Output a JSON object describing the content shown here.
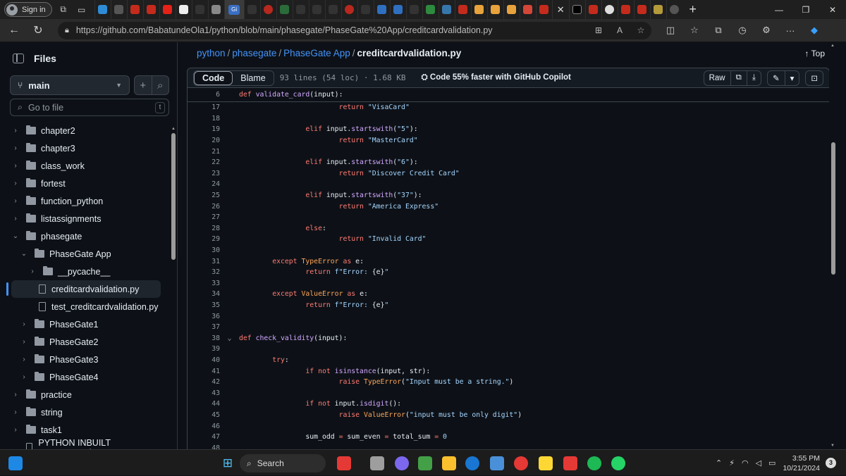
{
  "browser": {
    "signin_label": "Sign in",
    "active_tab_label": "Gi",
    "url": "https://github.com/BabatundeOla1/python/blob/main/phasegate/PhaseGate%20App/creditcardvalidation.py"
  },
  "sidebar": {
    "title": "Files",
    "branch": "main",
    "goto_placeholder": "Go to file",
    "goto_shortcut": "t",
    "items": [
      {
        "label": "chapter2",
        "type": "folder",
        "level": 0,
        "expanded": false
      },
      {
        "label": "chapter3",
        "type": "folder",
        "level": 0,
        "expanded": false
      },
      {
        "label": "class_work",
        "type": "folder",
        "level": 0,
        "expanded": false
      },
      {
        "label": "fortest",
        "type": "folder",
        "level": 0,
        "expanded": false
      },
      {
        "label": "function_python",
        "type": "folder",
        "level": 0,
        "expanded": false
      },
      {
        "label": "listassignments",
        "type": "folder",
        "level": 0,
        "expanded": false
      },
      {
        "label": "phasegate",
        "type": "folder",
        "level": 0,
        "expanded": true
      },
      {
        "label": "PhaseGate App",
        "type": "folder",
        "level": 1,
        "expanded": true
      },
      {
        "label": "__pycache__",
        "type": "folder",
        "level": 2,
        "expanded": false
      },
      {
        "label": "creditcardvalidation.py",
        "type": "file",
        "level": 2,
        "selected": true
      },
      {
        "label": "test_creditcardvalidation.py",
        "type": "file",
        "level": 2
      },
      {
        "label": "PhaseGate1",
        "type": "folder",
        "level": 1,
        "expanded": false
      },
      {
        "label": "PhaseGate2",
        "type": "folder",
        "level": 1,
        "expanded": false
      },
      {
        "label": "PhaseGate3",
        "type": "folder",
        "level": 1,
        "expanded": false
      },
      {
        "label": "PhaseGate4",
        "type": "folder",
        "level": 1,
        "expanded": false
      },
      {
        "label": "practice",
        "type": "folder",
        "level": 0,
        "expanded": false
      },
      {
        "label": "string",
        "type": "folder",
        "level": 0,
        "expanded": false
      },
      {
        "label": "task1",
        "type": "folder",
        "level": 0,
        "expanded": false
      },
      {
        "label": "PYTHON INBUILT FUNCTION.docx",
        "type": "file",
        "level": 0
      }
    ]
  },
  "breadcrumb": {
    "parts": [
      "python",
      "phasegate",
      "PhaseGate App"
    ],
    "current": "creditcardvalidation.py",
    "top_label": "Top"
  },
  "file_header": {
    "code_tab": "Code",
    "blame_tab": "Blame",
    "meta": "93 lines (54 loc) · 1.68 KB",
    "copilot": "Code 55% faster with GitHub Copilot",
    "raw_label": "Raw"
  },
  "code": {
    "sticky": {
      "num": "6",
      "text": "def validate_card(input):"
    },
    "lines": [
      {
        "num": "17",
        "indent": 3,
        "tokens": [
          [
            "kw",
            "return "
          ],
          [
            "st",
            "\"VisaCard\""
          ]
        ]
      },
      {
        "num": "18",
        "indent": 0,
        "tokens": []
      },
      {
        "num": "19",
        "indent": 2,
        "tokens": [
          [
            "kw",
            "elif "
          ],
          [
            "t",
            "input."
          ],
          [
            "fn",
            "startswith"
          ],
          [
            "t",
            "("
          ],
          [
            "st",
            "\"5\""
          ],
          [
            "t",
            "):"
          ]
        ]
      },
      {
        "num": "20",
        "indent": 3,
        "tokens": [
          [
            "kw",
            "return "
          ],
          [
            "st",
            "\"MasterCard\""
          ]
        ]
      },
      {
        "num": "21",
        "indent": 0,
        "tokens": []
      },
      {
        "num": "22",
        "indent": 2,
        "tokens": [
          [
            "kw",
            "elif "
          ],
          [
            "t",
            "input."
          ],
          [
            "fn",
            "startswith"
          ],
          [
            "t",
            "("
          ],
          [
            "st",
            "\"6\""
          ],
          [
            "t",
            "):"
          ]
        ]
      },
      {
        "num": "23",
        "indent": 3,
        "tokens": [
          [
            "kw",
            "return "
          ],
          [
            "st",
            "\"Discover Credit Card\""
          ]
        ]
      },
      {
        "num": "24",
        "indent": 0,
        "tokens": []
      },
      {
        "num": "25",
        "indent": 2,
        "tokens": [
          [
            "kw",
            "elif "
          ],
          [
            "t",
            "input."
          ],
          [
            "fn",
            "startswith"
          ],
          [
            "t",
            "("
          ],
          [
            "st",
            "\"37\""
          ],
          [
            "t",
            "):"
          ]
        ]
      },
      {
        "num": "26",
        "indent": 3,
        "tokens": [
          [
            "kw",
            "return "
          ],
          [
            "st",
            "\"America Express\""
          ]
        ]
      },
      {
        "num": "27",
        "indent": 0,
        "tokens": []
      },
      {
        "num": "28",
        "indent": 2,
        "tokens": [
          [
            "kw",
            "else"
          ],
          [
            "t",
            ":"
          ]
        ]
      },
      {
        "num": "29",
        "indent": 3,
        "tokens": [
          [
            "kw",
            "return "
          ],
          [
            "st",
            "\"Invalid Card\""
          ]
        ]
      },
      {
        "num": "30",
        "indent": 0,
        "tokens": []
      },
      {
        "num": "31",
        "indent": 1,
        "tokens": [
          [
            "kw",
            "except "
          ],
          [
            "bi2",
            "TypeError "
          ],
          [
            "kw",
            "as "
          ],
          [
            "t",
            "e:"
          ]
        ]
      },
      {
        "num": "32",
        "indent": 2,
        "tokens": [
          [
            "kw",
            "return "
          ],
          [
            "st",
            "f\"Error: "
          ],
          [
            "t",
            "{e}"
          ],
          [
            "st",
            "\""
          ]
        ]
      },
      {
        "num": "33",
        "indent": 0,
        "tokens": []
      },
      {
        "num": "34",
        "indent": 1,
        "tokens": [
          [
            "kw",
            "except "
          ],
          [
            "bi2",
            "ValueError "
          ],
          [
            "kw",
            "as "
          ],
          [
            "t",
            "e:"
          ]
        ]
      },
      {
        "num": "35",
        "indent": 2,
        "tokens": [
          [
            "kw",
            "return "
          ],
          [
            "st",
            "f\"Error: "
          ],
          [
            "t",
            "{e}"
          ],
          [
            "st",
            "\""
          ]
        ]
      },
      {
        "num": "36",
        "indent": 0,
        "tokens": []
      },
      {
        "num": "37",
        "indent": 0,
        "tokens": []
      },
      {
        "num": "38",
        "indent": 0,
        "fold": true,
        "tokens": [
          [
            "kw",
            "def "
          ],
          [
            "fn",
            "check_validity"
          ],
          [
            "t",
            "(input):"
          ]
        ]
      },
      {
        "num": "39",
        "indent": 0,
        "tokens": []
      },
      {
        "num": "40",
        "indent": 1,
        "tokens": [
          [
            "kw",
            "try"
          ],
          [
            "t",
            ":"
          ]
        ]
      },
      {
        "num": "41",
        "indent": 2,
        "tokens": [
          [
            "kw",
            "if not "
          ],
          [
            "fn",
            "isinstance"
          ],
          [
            "t",
            "(input, str):"
          ]
        ]
      },
      {
        "num": "42",
        "indent": 3,
        "tokens": [
          [
            "kw",
            "raise "
          ],
          [
            "bi2",
            "TypeError"
          ],
          [
            "t",
            "("
          ],
          [
            "st",
            "\"Input must be a string.\""
          ],
          [
            "t",
            ")"
          ]
        ]
      },
      {
        "num": "43",
        "indent": 0,
        "tokens": []
      },
      {
        "num": "44",
        "indent": 2,
        "tokens": [
          [
            "kw",
            "if not "
          ],
          [
            "t",
            "input."
          ],
          [
            "fn",
            "isdigit"
          ],
          [
            "t",
            "():"
          ]
        ]
      },
      {
        "num": "45",
        "indent": 3,
        "tokens": [
          [
            "kw",
            "raise "
          ],
          [
            "bi2",
            "ValueError"
          ],
          [
            "t",
            "("
          ],
          [
            "st",
            "\"input must be only digit\""
          ],
          [
            "t",
            ")"
          ]
        ]
      },
      {
        "num": "46",
        "indent": 0,
        "tokens": []
      },
      {
        "num": "47",
        "indent": 2,
        "tokens": [
          [
            "t",
            "sum_odd "
          ],
          [
            "kw",
            "= "
          ],
          [
            "t",
            "sum_even "
          ],
          [
            "kw",
            "= "
          ],
          [
            "t",
            "total_sum "
          ],
          [
            "kw",
            "= "
          ],
          [
            "st",
            "0"
          ]
        ]
      },
      {
        "num": "48",
        "indent": 0,
        "tokens": []
      }
    ]
  },
  "taskbar": {
    "search_label": "Search",
    "time": "3:55 PM",
    "date": "10/21/2024",
    "notifications": "3"
  }
}
